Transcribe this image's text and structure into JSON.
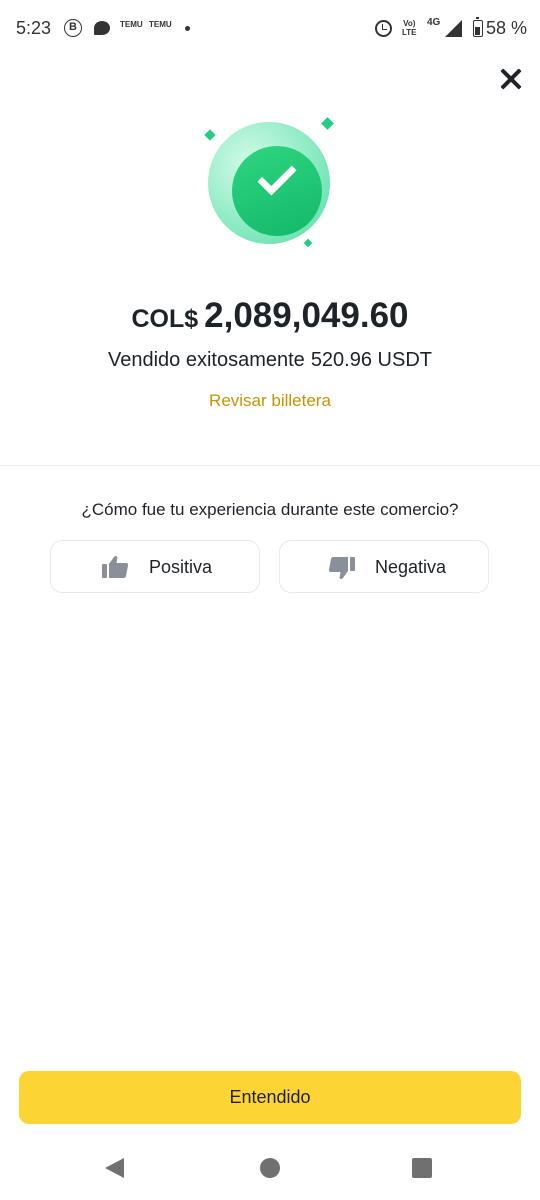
{
  "status_bar": {
    "time": "5:23",
    "b_badge": "B",
    "temu_1": "TEMU",
    "temu_2": "TEMU",
    "volte": "Vo)\nLTE",
    "network": "4G",
    "battery_percent": "58 %"
  },
  "icons": {
    "close": "close-icon",
    "success": "check-circle-icon",
    "thumbs_up": "thumbs-up-icon",
    "thumbs_down": "thumbs-down-icon"
  },
  "result": {
    "currency": "COL$",
    "amount": "2,089,049.60",
    "sold_text": "Vendido exitosamente",
    "sold_amount": "520.96 USDT",
    "wallet_link": "Revisar billetera"
  },
  "feedback": {
    "question": "¿Cómo fue tu experiencia durante este comercio?",
    "positive_label": "Positiva",
    "negative_label": "Negativa"
  },
  "primary_button": {
    "label": "Entendido"
  },
  "colors": {
    "accent_yellow": "#fcd535",
    "link_gold": "#c99400",
    "success_green": "#13b86a",
    "text_dark": "#1e2329"
  }
}
